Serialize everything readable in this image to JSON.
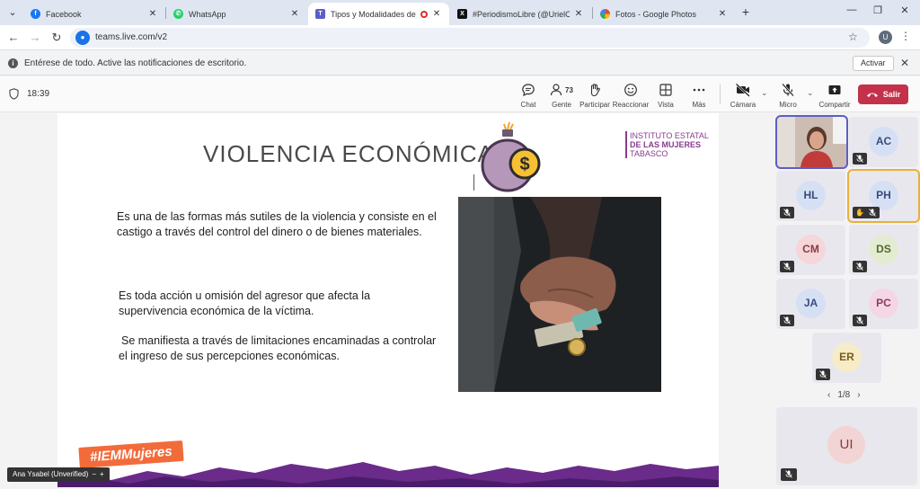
{
  "browser": {
    "tabs": [
      {
        "title": "Facebook",
        "icon": "facebook-icon",
        "color": "#1877f2"
      },
      {
        "title": "WhatsApp",
        "icon": "whatsapp-icon",
        "color": "#25d366"
      },
      {
        "title": "Tipos y Modalidades de Vic",
        "icon": "teams-icon",
        "color": "#5b5fc7"
      },
      {
        "title": "#PeriodismoLibre (@UrielCollac",
        "icon": "x-icon",
        "color": "#111111"
      },
      {
        "title": "Fotos - Google Photos",
        "icon": "google-photos-icon",
        "color": "#ea4335"
      }
    ],
    "url": "teams.live.com/v2",
    "profile_initial": "U",
    "notification": {
      "text": "Entérese de todo. Active las notificaciones de escritorio.",
      "button": "Activar"
    }
  },
  "meeting": {
    "time": "18:39",
    "people_count": "73",
    "toolbar": {
      "chat": "Chat",
      "people": "Gente",
      "raise": "Participar",
      "react": "Reaccionar",
      "view": "Vista",
      "more": "Más",
      "camera": "Cámara",
      "mic": "Micro",
      "share": "Compartir",
      "leave": "Salir"
    },
    "accent_color": "#5b5fc7",
    "leave_color": "#c4314b"
  },
  "slide": {
    "title": "VIOLENCIA ECONÓMICA",
    "institute": {
      "line1": "INSTITUTO ESTATAL",
      "line2": "DE LAS MUJERES",
      "line3": "TABASCO"
    },
    "para1_line1": "Es una de las formas más sutiles de la violencia y consiste en el",
    "para1_line2": "castigo a través del control del dinero o de bienes materiales.",
    "para2_line1": "Es toda acción u omisión del agresor que afecta la",
    "para2_line2": "supervivencia económica de la víctima.",
    "para3_line1": "Se manifiesta a través de limitaciones encaminadas a controlar",
    "para3_line2": "el ingreso de sus percepciones económicas.",
    "hashtag": "#IEMMujeres",
    "presenter": "Ana Ysabel (Unverified)",
    "brand_purple": "#8a3b8f",
    "brand_orange": "#f26b3a"
  },
  "participants": {
    "tiles": [
      {
        "initials": "AC",
        "bg": "#d6e0f5",
        "fg": "#3b4a7a"
      },
      {
        "initials": "HL",
        "bg": "#d6e0f5",
        "fg": "#3b4a7a"
      },
      {
        "initials": "PH",
        "bg": "#d6e0f5",
        "fg": "#3b4a7a"
      },
      {
        "initials": "CM",
        "bg": "#f5d6d9",
        "fg": "#8a3b45"
      },
      {
        "initials": "DS",
        "bg": "#e3ecd0",
        "fg": "#4f6a2a"
      },
      {
        "initials": "JA",
        "bg": "#d6e0f5",
        "fg": "#3b4a7a"
      },
      {
        "initials": "PC",
        "bg": "#f5d6e4",
        "fg": "#8a3b63"
      },
      {
        "initials": "ER",
        "bg": "#f7ecc8",
        "fg": "#7a5e1a"
      }
    ],
    "page": "1/8",
    "self_initials": "UI"
  }
}
